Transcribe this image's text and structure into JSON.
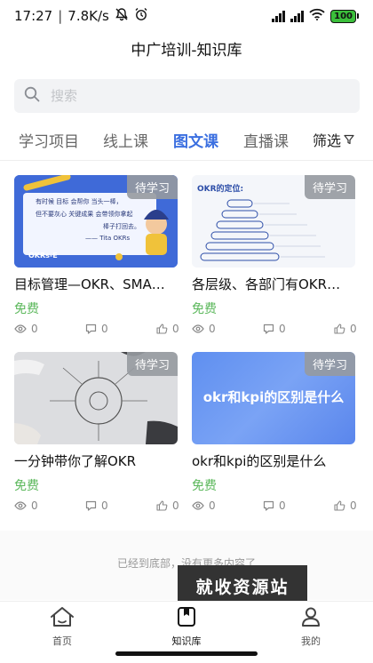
{
  "status_bar": {
    "time": "17:27",
    "speed": "7.8K/s",
    "battery": "100"
  },
  "app": {
    "title": "中广培训-知识库"
  },
  "search": {
    "placeholder": "搜索"
  },
  "tabs": [
    {
      "label": "学习项目",
      "active": false
    },
    {
      "label": "线上课",
      "active": false
    },
    {
      "label": "图文课",
      "active": true
    },
    {
      "label": "直播课",
      "active": false
    }
  ],
  "filter": {
    "label": "筛选"
  },
  "cards": [
    {
      "title": "目标管理—OKR、SMA…",
      "badge": "待学习",
      "price": "免费",
      "views": "0",
      "comments": "0",
      "likes": "0",
      "thumb": {
        "line1": "有时候 目标 会帮你 当头一棒，",
        "line2": "但不要灰心 关键成果 会带领你拿起",
        "line3": "棒子打回去。",
        "attribution": "—— Tita OKRs",
        "logo": "OKRs-E"
      }
    },
    {
      "title": "各层级、各部门有OKR…",
      "badge": "待学习",
      "price": "免费",
      "views": "0",
      "comments": "0",
      "likes": "0",
      "thumb": {
        "heading": "OKR的定位:"
      }
    },
    {
      "title": "一分钟带你了解OKR",
      "badge": "待学习",
      "price": "免费",
      "views": "0",
      "comments": "0",
      "likes": "0",
      "thumb": {}
    },
    {
      "title": "okr和kpi的区别是什么",
      "badge": "待学习",
      "price": "免费",
      "views": "0",
      "comments": "0",
      "likes": "0",
      "thumb": {
        "text": "okr和kpi的区别是什么"
      }
    }
  ],
  "end_message": "已经到底部，没有更多内容了",
  "watermark": "就收资源站",
  "bottom_nav": [
    {
      "label": "首页",
      "icon": "home-icon",
      "active": false
    },
    {
      "label": "知识库",
      "icon": "book-icon",
      "active": true
    },
    {
      "label": "我的",
      "icon": "user-icon",
      "active": false
    }
  ],
  "colors": {
    "accent": "#3b6fe0",
    "free": "#5cb85c",
    "badge": "#969aa0"
  }
}
